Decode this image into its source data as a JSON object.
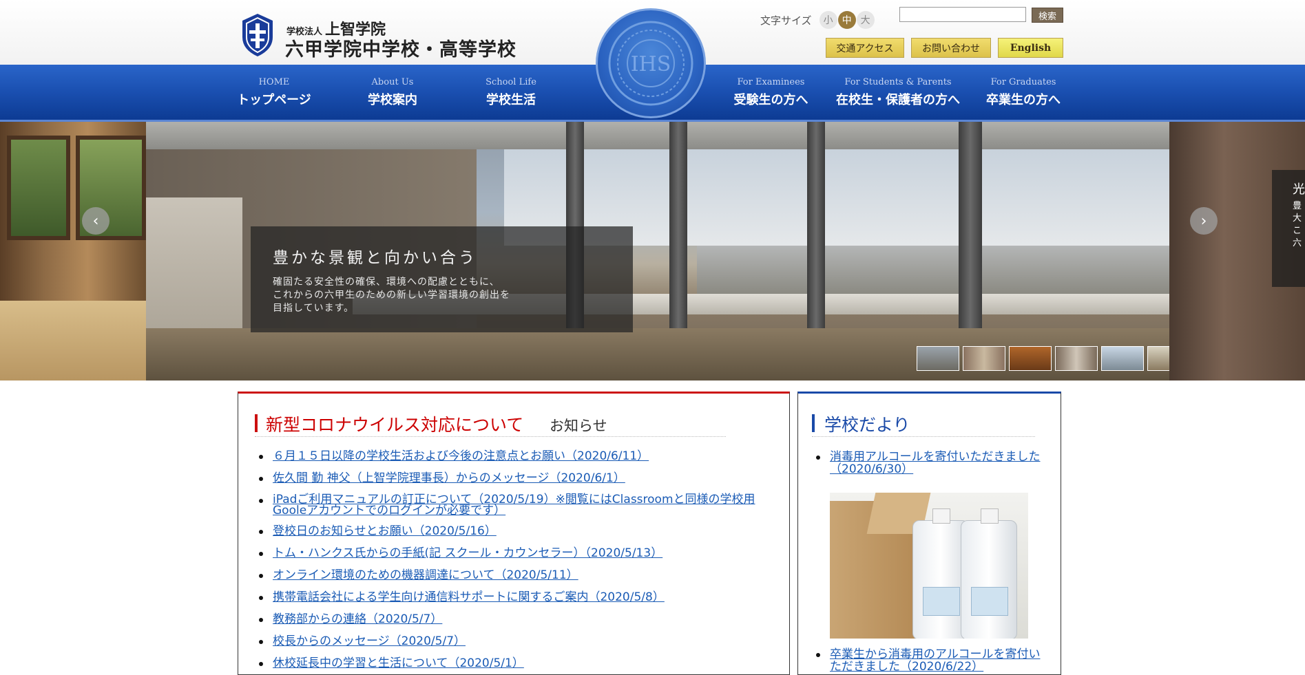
{
  "header": {
    "logo_small_prefix": "学校法人",
    "logo_small": "上智学院",
    "logo_big": "六甲学院中学校・高等学校",
    "fontsize_label": "文字サイズ",
    "fontsize_options": [
      "小",
      "中",
      "大"
    ],
    "fontsize_selected": "中",
    "search_value": "",
    "search_button": "検索",
    "access_button": "交通アクセス",
    "contact_button": "お問い合わせ",
    "english_button": "English"
  },
  "nav": {
    "items": [
      {
        "en": "HOME",
        "ja": "トップページ"
      },
      {
        "en": "About Us",
        "ja": "学校案内"
      },
      {
        "en": "School Life",
        "ja": "学校生活"
      },
      {
        "en": "For Examinees",
        "ja": "受験生の方へ"
      },
      {
        "en": "For Students & Parents",
        "ja": "在校生・保護者の方へ"
      },
      {
        "en": "For Graduates",
        "ja": "卒業生の方へ"
      }
    ]
  },
  "slider": {
    "caption_title": "豊かな景観と向かい合う",
    "caption_lines": [
      "確固たる安全性の確保、環境への配慮とともに、",
      "これからの六甲生のための新しい学習環境の創出を",
      "目指しています。"
    ],
    "next_slide_peek": [
      "光",
      "豊",
      "大",
      "こ",
      "六"
    ],
    "prev_icon": "chevron-left-icon",
    "next_icon": "chevron-right-icon"
  },
  "news": {
    "title": "新型コロナウイルス対応について",
    "subtitle": "お知らせ",
    "items": [
      "６月１５日以降の学校生活および今後の注意点とお願い（2020/6/11）",
      "佐久間 勤 神父（上智学院理事長）からのメッセージ（2020/6/1）",
      "iPadご利用マニュアルの訂正について（2020/5/19）※閲覧にはClassroomと同様の学校用Gooleアカウントでのログインが必要です）",
      "登校日のお知らせとお願い（2020/5/16）",
      "トム・ハンクス氏からの手紙(記 スクール・カウンセラー）（2020/5/13）",
      "オンライン環境のための機器調達について（2020/5/11）",
      "携帯電話会社による学生向け通信料サポートに関するご案内（2020/5/8）",
      "教務部からの連絡（2020/5/7）",
      "校長からのメッセージ（2020/5/7）",
      "休校延長中の学習と生活について（2020/5/1）"
    ]
  },
  "letters": {
    "title": "学校だより",
    "items": [
      "消毒用アルコールを寄付いただきました（2020/6/30）",
      "卒業生から消毒用のアルコールを寄付いただきました（2020/6/22）"
    ]
  },
  "colors": {
    "nav_blue": "#1a4fb0",
    "news_red": "#cc1010",
    "letters_blue": "#1a4aa8",
    "link": "#1a5bb5"
  }
}
